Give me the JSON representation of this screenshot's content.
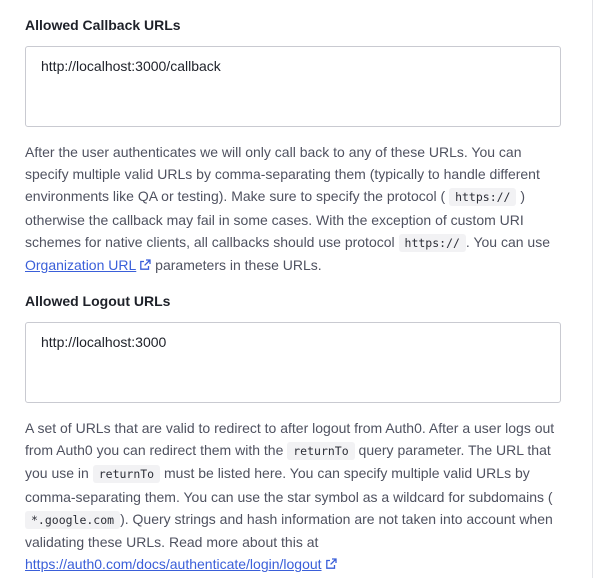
{
  "callback": {
    "label": "Allowed Callback URLs",
    "value": "http://localhost:3000/callback",
    "help": {
      "t1": "After the user authenticates we will only call back to any of these URLs. You can specify multiple valid URLs by comma-separating them (typically to handle different environments like QA or testing). Make sure to specify the protocol (",
      "code1": "https://",
      "t2": ") otherwise the callback may fail in some cases. With the exception of custom URI schemes for native clients, all callbacks should use protocol",
      "code2": "https://",
      "t3": ". You can use",
      "link": "Organization URL",
      "t4": "parameters in these URLs."
    }
  },
  "logout": {
    "label": "Allowed Logout URLs",
    "value": "http://localhost:3000",
    "help": {
      "t1": "A set of URLs that are valid to redirect to after logout from Auth0. After a user logs out from Auth0 you can redirect them with the",
      "code1": "returnTo",
      "t2": "query parameter. The URL that you use in",
      "code2": "returnTo",
      "t3": "must be listed here. You can specify multiple valid URLs by comma-separating them. You can use the star symbol as a wildcard for subdomains (",
      "code3": "*.google.com",
      "t4": "). Query strings and hash information are not taken into account when validating these URLs. Read more about this at",
      "link": "https://auth0.com/docs/authenticate/login/logout"
    }
  },
  "colors": {
    "link": "#3a5fd9",
    "text": "#4f5260",
    "code_bg": "#f2f2f4",
    "border": "#c9cad1"
  },
  "icons": [
    "external-link-icon"
  ]
}
